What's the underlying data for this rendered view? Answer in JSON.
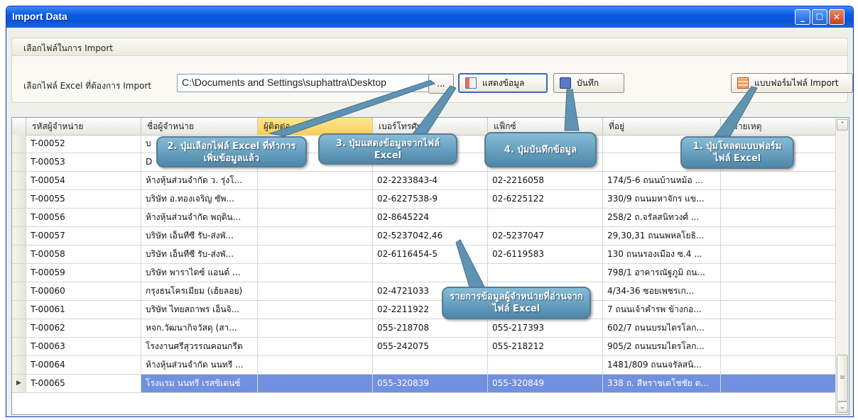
{
  "window": {
    "title": "Import Data",
    "minimize_glyph": "_",
    "maximize_glyph": "☐",
    "close_glyph": "✕"
  },
  "group": {
    "title": "เลือกไฟล์ในการ Import",
    "file_label": "เลือกไฟล์ Excel ที่ต้องการ Import",
    "file_path": "C:\\Documents and Settings\\suphattra\\Desktop",
    "browse_label": "...",
    "show_label": "แสดงข้อมูล",
    "save_label": "บันทึก",
    "template_label": "แบบฟอร์มไฟล์ Import"
  },
  "grid": {
    "columns": [
      "รหัสผู้จำหน่าย",
      "ชื่อผู้จำหน่าย",
      "ผู้ติดต่อ",
      "เบอร์โทรศัพท์",
      "แฟ็กซ์",
      "ที่อยู่",
      "หมายเหตุ"
    ],
    "rows": [
      {
        "code": "T-00052",
        "name": "บ",
        "contact": "",
        "phone": "",
        "fax": "",
        "address": "",
        "note": ""
      },
      {
        "code": "T-00053",
        "name": "D",
        "contact": "",
        "phone": "",
        "fax": "",
        "address": "",
        "note": ""
      },
      {
        "code": "T-00054",
        "name": "ห้างหุ้นส่วนจำกัด ว. รุ่งโ...",
        "contact": "",
        "phone": "02-2233843-4",
        "fax": "02-2216058",
        "address": "174/5-6 ถนนบ้านหม้อ ...",
        "note": ""
      },
      {
        "code": "T-00055",
        "name": "บริษัท อ.ทองเจริญ ซัพ...",
        "contact": "",
        "phone": "02-6227538-9",
        "fax": "02-6225122",
        "address": "330/9 ถนนมหาจักร แข...",
        "note": ""
      },
      {
        "code": "T-00056",
        "name": "ห้างหุ้นส่วนจำกัด พฤดิน...",
        "contact": "",
        "phone": "02-8645224",
        "fax": "",
        "address": "258/2 ถ.จรัลสนิทวงศ์ ...",
        "note": ""
      },
      {
        "code": "T-00057",
        "name": "บริษัท เอ็นทีซี รับ-ส่งพั...",
        "contact": "",
        "phone": "02-5237042,46",
        "fax": "02-5237047",
        "address": "29,30,31 ถนนพหลโยธิ...",
        "note": ""
      },
      {
        "code": "T-00058",
        "name": "บริษัท เอ็นทีซี รับ-ส่งพั...",
        "contact": "",
        "phone": "02-6116454-5",
        "fax": "02-6119583",
        "address": "130 ถนนรองเมือง ซ.4 ...",
        "note": ""
      },
      {
        "code": "T-00059",
        "name": "บริษัท พาราไดซ์ แอนด์ ...",
        "contact": "",
        "phone": "",
        "fax": "",
        "address": "798/1 อาคารณัฐภูมิ ถน...",
        "note": ""
      },
      {
        "code": "T-00060",
        "name": "กรุงธนโครเมียม (เฮ้ยลอย)",
        "contact": "",
        "phone": "02-4721033",
        "fax": "",
        "address": "4/34-36 ซอยเพชรเก...",
        "note": ""
      },
      {
        "code": "T-00061",
        "name": "บริษัท ไทยสถาพร เอ็นจิ...",
        "contact": "",
        "phone": "02-2211922",
        "fax": "",
        "address": "7 ถนนเจ้าคำรพ ข้างกอ...",
        "note": ""
      },
      {
        "code": "T-00062",
        "name": "หจก.วัฒนากิจวัสดุ (สา...",
        "contact": "",
        "phone": "055-218708",
        "fax": "055-217393",
        "address": "602/7 ถนนบรมไตรโลก...",
        "note": ""
      },
      {
        "code": "T-00063",
        "name": "โรงงานศรีสุวรรณคอนกรีต",
        "contact": "",
        "phone": "055-242075",
        "fax": "055-218212",
        "address": "905/2 ถนนบรมไตรโลก...",
        "note": ""
      },
      {
        "code": "T-00064",
        "name": "ห้างหุ้นส่วนจำกัด นนทรี ...",
        "contact": "",
        "phone": "",
        "fax": "",
        "address": "1481/809 ถนนจรัลสนิ...",
        "note": ""
      },
      {
        "code": "T-00065",
        "name": "โรงแรม นนทรี เรสซิเดนซ์",
        "contact": "",
        "phone": "055-320839",
        "fax": "055-320849",
        "address": "338 ถ. สีหราชเดโชชัย ต...",
        "note": ""
      }
    ],
    "selected_row_marker": "▶",
    "scroll_up_glyph": "⌃",
    "scroll_down_glyph": "⌄",
    "scroll_thumb_glyph": "≡"
  },
  "callouts": {
    "c1": "1. ปุ่มโหลดแบบฟอร์มไฟล์ Excel",
    "c2": "2. ปุ่มเลือกไฟล์ Excel ที่ทำการเพิ่มข้อมูลแล้ว",
    "c3": "3. ปุ่มแสดงข้อมูลจากไฟล์ Excel",
    "c4": "4. ปุ่มบันทึกข้อมูล",
    "c5": "รายการข้อมูลผู้จำหน่ายที่อ่านจากไฟล์ Excel"
  },
  "colors": {
    "titlebar": "#0a5be0",
    "selected_row": "#7290e0",
    "sorted_header": "#f9cf58",
    "callout": "#4d87a8"
  }
}
